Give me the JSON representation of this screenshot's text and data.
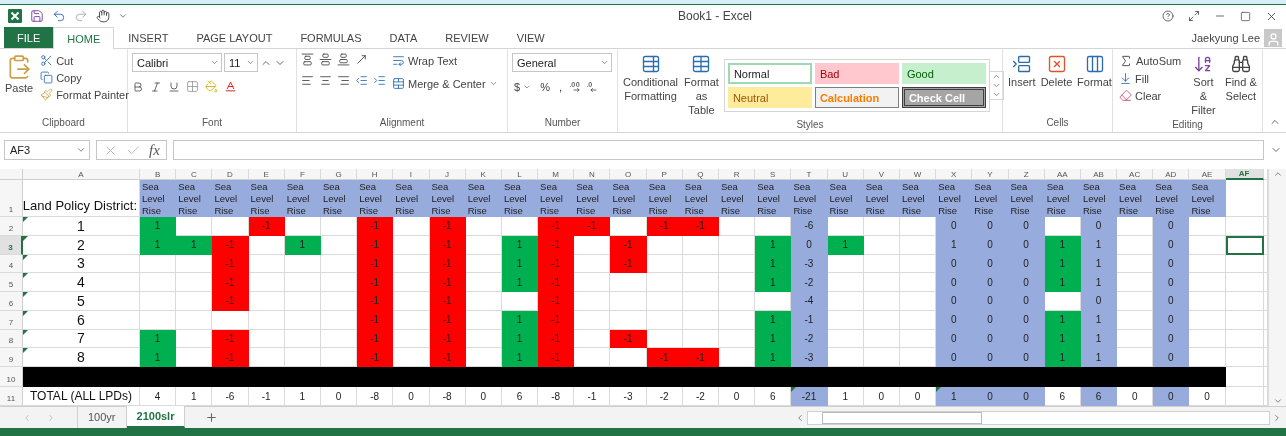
{
  "window": {
    "title": "Book1 - Excel",
    "user": "Jaekyung Lee"
  },
  "file_button": "FILE",
  "menu_tabs": [
    {
      "label": "HOME",
      "selected": true
    },
    {
      "label": "INSERT",
      "selected": false
    },
    {
      "label": "PAGE LAYOUT",
      "selected": false
    },
    {
      "label": "FORMULAS",
      "selected": false
    },
    {
      "label": "DATA",
      "selected": false
    },
    {
      "label": "REVIEW",
      "selected": false
    },
    {
      "label": "VIEW",
      "selected": false
    }
  ],
  "ribbon": {
    "clipboard": {
      "label": "Clipboard",
      "paste": "Paste",
      "cut": "Cut",
      "copy": "Copy",
      "format_painter": "Format Painter"
    },
    "font": {
      "label": "Font",
      "name": "Calibri",
      "size": "11"
    },
    "alignment": {
      "label": "Alignment",
      "wrap": "Wrap Text",
      "merge": "Merge & Center"
    },
    "number": {
      "label": "Number",
      "format": "General",
      "currency": "$",
      "percent": "%",
      "comma": ","
    },
    "styles": {
      "label": "Styles",
      "conditional": "Conditional Formatting",
      "format_table": "Format as Table",
      "cell_styles": [
        {
          "label": "Normal",
          "kind": "normal"
        },
        {
          "label": "Bad",
          "kind": "bad"
        },
        {
          "label": "Good",
          "kind": "good"
        },
        {
          "label": "Neutral",
          "kind": "neutral"
        },
        {
          "label": "Calculation",
          "kind": "calculation"
        },
        {
          "label": "Check Cell",
          "kind": "check"
        }
      ]
    },
    "cells": {
      "label": "Cells",
      "insert": "Insert",
      "delete": "Delete",
      "format": "Format"
    },
    "editing": {
      "label": "Editing",
      "autosum": "AutoSum",
      "fill": "Fill",
      "clear": "Clear",
      "sort": "Sort & Filter",
      "find": "Find & Select"
    }
  },
  "formula_bar": {
    "name_box": "AF3",
    "function_label": "fx"
  },
  "column_headers": [
    {
      "letter": "A",
      "selected": false
    },
    {
      "letter": "B",
      "selected": false
    },
    {
      "letter": "C",
      "selected": false
    },
    {
      "letter": "D",
      "selected": false
    },
    {
      "letter": "E",
      "selected": false
    },
    {
      "letter": "F",
      "selected": false
    },
    {
      "letter": "G",
      "selected": false
    },
    {
      "letter": "H",
      "selected": false
    },
    {
      "letter": "I",
      "selected": false
    },
    {
      "letter": "J",
      "selected": false
    },
    {
      "letter": "K",
      "selected": false
    },
    {
      "letter": "L",
      "selected": false
    },
    {
      "letter": "M",
      "selected": false
    },
    {
      "letter": "N",
      "selected": false
    },
    {
      "letter": "O",
      "selected": false
    },
    {
      "letter": "P",
      "selected": false
    },
    {
      "letter": "Q",
      "selected": false
    },
    {
      "letter": "R",
      "selected": false
    },
    {
      "letter": "S",
      "selected": false
    },
    {
      "letter": "T",
      "selected": false
    },
    {
      "letter": "U",
      "selected": false
    },
    {
      "letter": "V",
      "selected": false
    },
    {
      "letter": "W",
      "selected": false
    },
    {
      "letter": "X",
      "selected": false
    },
    {
      "letter": "Y",
      "selected": false
    },
    {
      "letter": "Z",
      "selected": false
    },
    {
      "letter": "AA",
      "selected": false
    },
    {
      "letter": "AB",
      "selected": false
    },
    {
      "letter": "AC",
      "selected": false
    },
    {
      "letter": "AD",
      "selected": false
    },
    {
      "letter": "AE",
      "selected": false
    },
    {
      "letter": "AF",
      "selected": true
    }
  ],
  "row_headers": [
    {
      "number": "1",
      "selected": false
    },
    {
      "number": "2",
      "selected": false
    },
    {
      "number": "3",
      "selected": true
    },
    {
      "number": "4",
      "selected": false
    },
    {
      "number": "5",
      "selected": false
    },
    {
      "number": "6",
      "selected": false
    },
    {
      "number": "7",
      "selected": false
    },
    {
      "number": "8",
      "selected": false
    },
    {
      "number": "9",
      "selected": false
    },
    {
      "number": "10",
      "selected": false
    },
    {
      "number": "11",
      "selected": false
    }
  ],
  "district_header": "Land Policy District:",
  "districts": [
    {
      "label": "1",
      "flag": true
    },
    {
      "label": "2",
      "flag": true
    },
    {
      "label": "3",
      "flag": true
    },
    {
      "label": "4",
      "flag": true
    },
    {
      "label": "5",
      "flag": true
    },
    {
      "label": "6",
      "flag": true
    },
    {
      "label": "7",
      "flag": true
    },
    {
      "label": "8",
      "flag": true
    }
  ],
  "total_label": "TOTAL (ALL LPDs)",
  "data_columns": [
    {
      "header": "Sea Level Rise",
      "band": false,
      "total": "4",
      "total_flag": false,
      "cells": [
        {
          "text": "1",
          "color": "#00b050"
        },
        {
          "text": "1",
          "color": "#00b050"
        },
        null,
        null,
        null,
        null,
        {
          "text": "1",
          "color": "#00b050"
        },
        {
          "text": "1",
          "color": "#00b050"
        }
      ]
    },
    {
      "header": "Sea Level Rise",
      "band": false,
      "total": "1",
      "total_flag": false,
      "cells": [
        null,
        {
          "text": "1",
          "color": "#00b050"
        },
        null,
        null,
        null,
        null,
        null,
        null
      ]
    },
    {
      "header": "Sea Level Rise",
      "band": false,
      "total": "-6",
      "total_flag": false,
      "cells": [
        null,
        {
          "text": "-1",
          "color": "#ff0000"
        },
        {
          "text": "-1",
          "color": "#ff0000"
        },
        {
          "text": "-1",
          "color": "#ff0000"
        },
        {
          "text": "-1",
          "color": "#ff0000"
        },
        null,
        {
          "text": "-1",
          "color": "#ff0000"
        },
        {
          "text": "-1",
          "color": "#ff0000"
        }
      ]
    },
    {
      "header": "Sea Level Rise",
      "band": false,
      "total": "-1",
      "total_flag": false,
      "cells": [
        {
          "text": "-1",
          "color": "#ff0000"
        },
        null,
        null,
        null,
        null,
        null,
        null,
        null
      ]
    },
    {
      "header": "Sea Level Rise",
      "band": false,
      "total": "1",
      "total_flag": false,
      "cells": [
        null,
        {
          "text": "1",
          "color": "#00b050"
        },
        null,
        null,
        null,
        null,
        null,
        null
      ]
    },
    {
      "header": "Sea Level Rise",
      "band": false,
      "total": "0",
      "total_flag": false,
      "cells": [
        null,
        null,
        null,
        null,
        null,
        null,
        null,
        null
      ]
    },
    {
      "header": "Sea Level Rise",
      "band": false,
      "total": "-8",
      "total_flag": false,
      "cells": [
        {
          "text": "-1",
          "color": "#ff0000"
        },
        {
          "text": "-1",
          "color": "#ff0000"
        },
        {
          "text": "-1",
          "color": "#ff0000"
        },
        {
          "text": "-1",
          "color": "#ff0000"
        },
        {
          "text": "-1",
          "color": "#ff0000"
        },
        {
          "text": "-1",
          "color": "#ff0000"
        },
        {
          "text": "-1",
          "color": "#ff0000"
        },
        {
          "text": "-1",
          "color": "#ff0000"
        }
      ]
    },
    {
      "header": "Sea Level Rise",
      "band": false,
      "total": "0",
      "total_flag": false,
      "cells": [
        null,
        null,
        null,
        null,
        null,
        null,
        null,
        null
      ]
    },
    {
      "header": "Sea Level Rise",
      "band": false,
      "total": "-8",
      "total_flag": false,
      "cells": [
        {
          "text": "-1",
          "color": "#ff0000"
        },
        {
          "text": "-1",
          "color": "#ff0000"
        },
        {
          "text": "-1",
          "color": "#ff0000"
        },
        {
          "text": "-1",
          "color": "#ff0000"
        },
        {
          "text": "-1",
          "color": "#ff0000"
        },
        {
          "text": "-1",
          "color": "#ff0000"
        },
        {
          "text": "-1",
          "color": "#ff0000"
        },
        {
          "text": "-1",
          "color": "#ff0000"
        }
      ]
    },
    {
      "header": "Sea Level Rise",
      "band": false,
      "total": "0",
      "total_flag": false,
      "cells": [
        null,
        null,
        null,
        null,
        null,
        null,
        null,
        null
      ]
    },
    {
      "header": "Sea Level Rise",
      "band": false,
      "total": "6",
      "total_flag": false,
      "cells": [
        null,
        {
          "text": "1",
          "color": "#00b050"
        },
        {
          "text": "1",
          "color": "#00b050"
        },
        {
          "text": "1",
          "color": "#00b050"
        },
        null,
        {
          "text": "1",
          "color": "#00b050"
        },
        {
          "text": "1",
          "color": "#00b050"
        },
        {
          "text": "1",
          "color": "#00b050"
        }
      ]
    },
    {
      "header": "Sea Level Rise",
      "band": false,
      "total": "-8",
      "total_flag": false,
      "cells": [
        {
          "text": "-1",
          "color": "#ff0000"
        },
        {
          "text": "-1",
          "color": "#ff0000"
        },
        {
          "text": "-1",
          "color": "#ff0000"
        },
        {
          "text": "-1",
          "color": "#ff0000"
        },
        {
          "text": "-1",
          "color": "#ff0000"
        },
        {
          "text": "-1",
          "color": "#ff0000"
        },
        {
          "text": "-1",
          "color": "#ff0000"
        },
        {
          "text": "-1",
          "color": "#ff0000"
        }
      ]
    },
    {
      "header": "Sea Level Rise",
      "band": false,
      "total": "-1",
      "total_flag": false,
      "cells": [
        {
          "text": "-1",
          "color": "#ff0000"
        },
        null,
        null,
        null,
        null,
        null,
        null,
        null
      ]
    },
    {
      "header": "Sea Level Rise",
      "band": false,
      "total": "-3",
      "total_flag": false,
      "cells": [
        null,
        {
          "text": "-1",
          "color": "#ff0000"
        },
        {
          "text": "-1",
          "color": "#ff0000"
        },
        null,
        null,
        null,
        {
          "text": "-1",
          "color": "#ff0000"
        },
        null
      ]
    },
    {
      "header": "Sea Level Rise",
      "band": false,
      "total": "-2",
      "total_flag": false,
      "cells": [
        {
          "text": "-1",
          "color": "#ff0000"
        },
        null,
        null,
        null,
        null,
        null,
        null,
        {
          "text": "-1",
          "color": "#ff0000"
        }
      ]
    },
    {
      "header": "Sea Level Rise",
      "band": false,
      "total": "-2",
      "total_flag": false,
      "cells": [
        {
          "text": "-1",
          "color": "#ff0000"
        },
        null,
        null,
        null,
        null,
        null,
        null,
        {
          "text": "-1",
          "color": "#ff0000"
        }
      ]
    },
    {
      "header": "Sea Level Rise",
      "band": false,
      "total": "0",
      "total_flag": false,
      "cells": [
        null,
        null,
        null,
        null,
        null,
        null,
        null,
        null
      ]
    },
    {
      "header": "Sea Level Rise",
      "band": false,
      "total": "6",
      "total_flag": false,
      "cells": [
        null,
        {
          "text": "1",
          "color": "#00b050"
        },
        {
          "text": "1",
          "color": "#00b050"
        },
        {
          "text": "1",
          "color": "#00b050"
        },
        null,
        {
          "text": "1",
          "color": "#00b050"
        },
        {
          "text": "1",
          "color": "#00b050"
        },
        {
          "text": "1",
          "color": "#00b050"
        }
      ]
    },
    {
      "header": "Sea Level Rise",
      "band": true,
      "total": "-21",
      "total_flag": true,
      "cells": [
        {
          "text": "-6"
        },
        {
          "text": "0"
        },
        {
          "text": "-3"
        },
        {
          "text": "-2"
        },
        {
          "text": "-4"
        },
        {
          "text": "-1"
        },
        {
          "text": "-2"
        },
        {
          "text": "-3"
        }
      ]
    },
    {
      "header": "Sea Level Rise",
      "band": false,
      "total": "1",
      "total_flag": false,
      "cells": [
        null,
        {
          "text": "1",
          "color": "#00b050"
        },
        null,
        null,
        null,
        null,
        null,
        null
      ]
    },
    {
      "header": "Sea Level Rise",
      "band": false,
      "total": "0",
      "total_flag": false,
      "cells": [
        null,
        null,
        null,
        null,
        null,
        null,
        null,
        null
      ]
    },
    {
      "header": "Sea Level Rise",
      "band": false,
      "total": "0",
      "total_flag": false,
      "cells": [
        null,
        null,
        null,
        null,
        null,
        null,
        null,
        null
      ]
    },
    {
      "header": "Sea Level Rise",
      "band": true,
      "total": "1",
      "total_flag": true,
      "cells": [
        {
          "text": "0"
        },
        {
          "text": "1"
        },
        {
          "text": "0"
        },
        {
          "text": "0"
        },
        {
          "text": "0"
        },
        {
          "text": "0"
        },
        {
          "text": "0"
        },
        {
          "text": "0"
        }
      ]
    },
    {
      "header": "Sea Level Rise",
      "band": true,
      "total": "0",
      "total_flag": false,
      "cells": [
        {
          "text": "0"
        },
        {
          "text": "0"
        },
        {
          "text": "0"
        },
        {
          "text": "0"
        },
        {
          "text": "0"
        },
        {
          "text": "0"
        },
        {
          "text": "0"
        },
        {
          "text": "0"
        }
      ]
    },
    {
      "header": "Sea Level Rise",
      "band": true,
      "total": "0",
      "total_flag": false,
      "cells": [
        {
          "text": "0"
        },
        {
          "text": "0"
        },
        {
          "text": "0"
        },
        {
          "text": "0"
        },
        {
          "text": "0"
        },
        {
          "text": "0"
        },
        {
          "text": "0"
        },
        {
          "text": "0"
        }
      ]
    },
    {
      "header": "Sea Level Rise",
      "band": false,
      "total": "6",
      "total_flag": false,
      "cells": [
        null,
        {
          "text": "1",
          "color": "#00b050"
        },
        {
          "text": "1",
          "color": "#00b050"
        },
        {
          "text": "1",
          "color": "#00b050"
        },
        null,
        {
          "text": "1",
          "color": "#00b050"
        },
        {
          "text": "1",
          "color": "#00b050"
        },
        {
          "text": "1",
          "color": "#00b050"
        }
      ]
    },
    {
      "header": "Sea Level Rise",
      "band": true,
      "total": "6",
      "total_flag": false,
      "cells": [
        {
          "text": "0"
        },
        {
          "text": "1"
        },
        {
          "text": "1"
        },
        {
          "text": "1"
        },
        {
          "text": "0"
        },
        {
          "text": "1"
        },
        {
          "text": "1"
        },
        {
          "text": "1"
        }
      ]
    },
    {
      "header": "Sea Level Rise",
      "band": false,
      "total": "0",
      "total_flag": false,
      "cells": [
        null,
        null,
        null,
        null,
        null,
        null,
        null,
        null
      ]
    },
    {
      "header": "Sea Level Rise",
      "band": true,
      "total": "0",
      "total_flag": false,
      "cells": [
        {
          "text": "0"
        },
        {
          "text": "0"
        },
        {
          "text": "0"
        },
        {
          "text": "0"
        },
        {
          "text": "0"
        },
        {
          "text": "0"
        },
        {
          "text": "0"
        },
        {
          "text": "0"
        }
      ]
    },
    {
      "header": "Sea Level Rise",
      "band": false,
      "total": "0",
      "total_flag": false,
      "cells": [
        null,
        null,
        null,
        null,
        null,
        null,
        null,
        null
      ]
    }
  ],
  "sheet_tabs": [
    {
      "label": "100yr",
      "selected": false
    },
    {
      "label": "2100slr",
      "selected": true
    }
  ]
}
